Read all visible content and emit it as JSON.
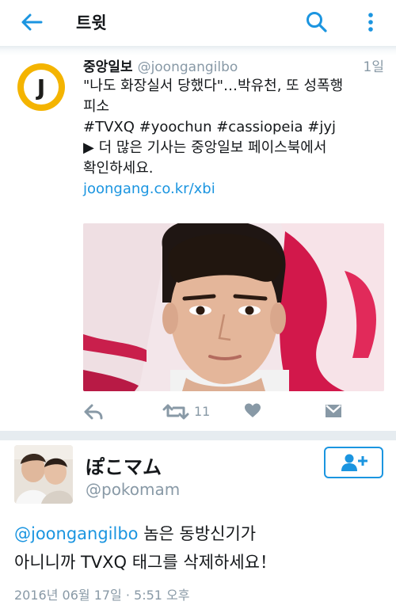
{
  "appbar": {
    "title": "트윗"
  },
  "tweet1": {
    "author_name": "중앙일보",
    "author_handle": "@joongangilbo",
    "time": "1일",
    "avatar_letter": "J",
    "body_lines": [
      "\"나도 화장실서 당했다\"…박유천, 또 성폭행",
      "피소",
      "#TVXQ #yoochun #cassiopeia #jyj",
      "▶ 더 많은 기사는 중앙일보 페이스북에서",
      "확인하세요."
    ],
    "link": "joongang.co.kr/xbi",
    "retweet_count": "11"
  },
  "tweet2": {
    "author_name": "ぽこマム",
    "author_handle": "@pokomam",
    "mention": "@joongangilbo",
    "body_line1_rest": " 놈은 동방신기가",
    "body_line2": "아니니까 TVXQ 태그를 삭제하세요！",
    "date": "2016년 06월 17일 · 5:51 오후"
  },
  "colors": {
    "accent": "#1b95e0",
    "muted": "#8899a6",
    "logo_yellow": "#f4b400"
  }
}
